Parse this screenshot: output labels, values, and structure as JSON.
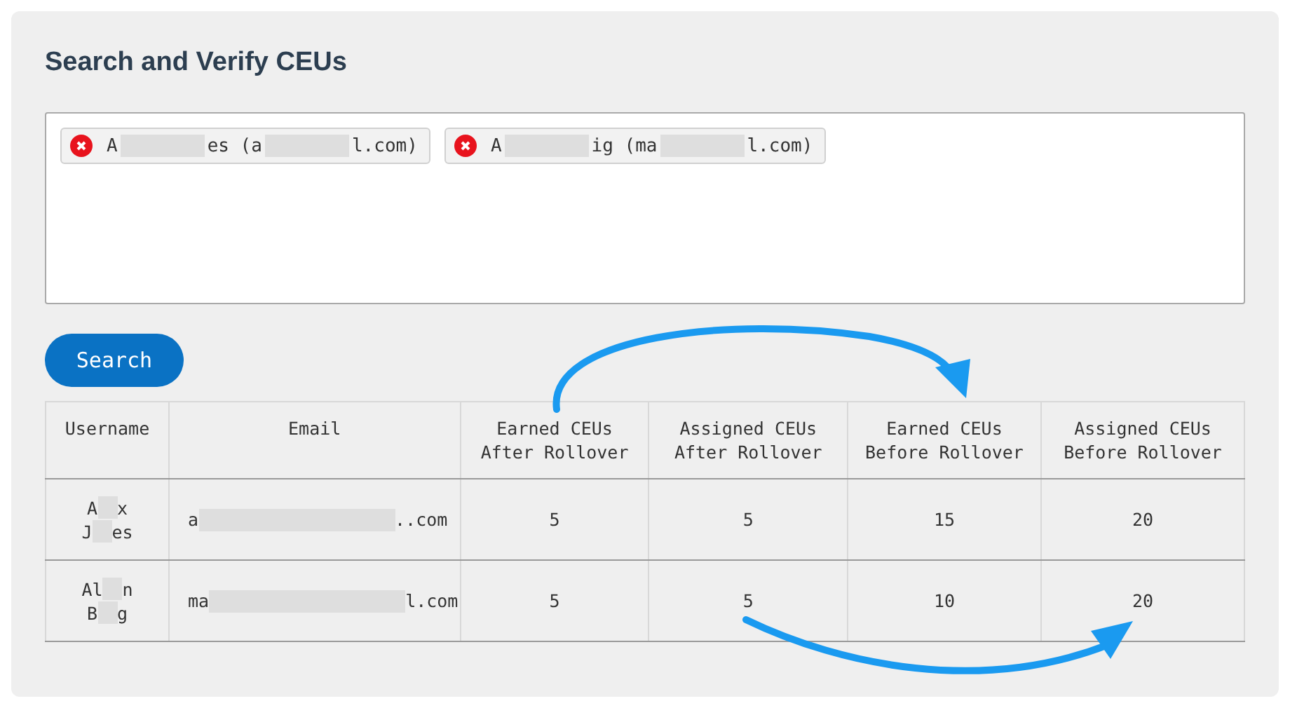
{
  "title": "Search and Verify CEUs",
  "chips": [
    {
      "parts": [
        "A",
        "es (a",
        "l.com)"
      ]
    },
    {
      "parts": [
        "A",
        "ig (ma",
        "l.com)"
      ]
    }
  ],
  "search_button": "Search",
  "table": {
    "columns": [
      "Username",
      "Email",
      "Earned CEUs After Rollover",
      "Assigned CEUs After Rollover",
      "Earned CEUs Before Rollover",
      "Assigned CEUs Before Rollover"
    ],
    "rows": [
      {
        "username": [
          [
            "A",
            "x"
          ],
          [
            "J",
            "es"
          ]
        ],
        "email": [
          "a",
          "..com"
        ],
        "values": [
          "5",
          "5",
          "15",
          "20"
        ]
      },
      {
        "username": [
          [
            "Al",
            "n"
          ],
          [
            "B",
            "g"
          ]
        ],
        "email": [
          "ma",
          "l.com"
        ],
        "values": [
          "5",
          "5",
          "10",
          "20"
        ]
      }
    ]
  }
}
